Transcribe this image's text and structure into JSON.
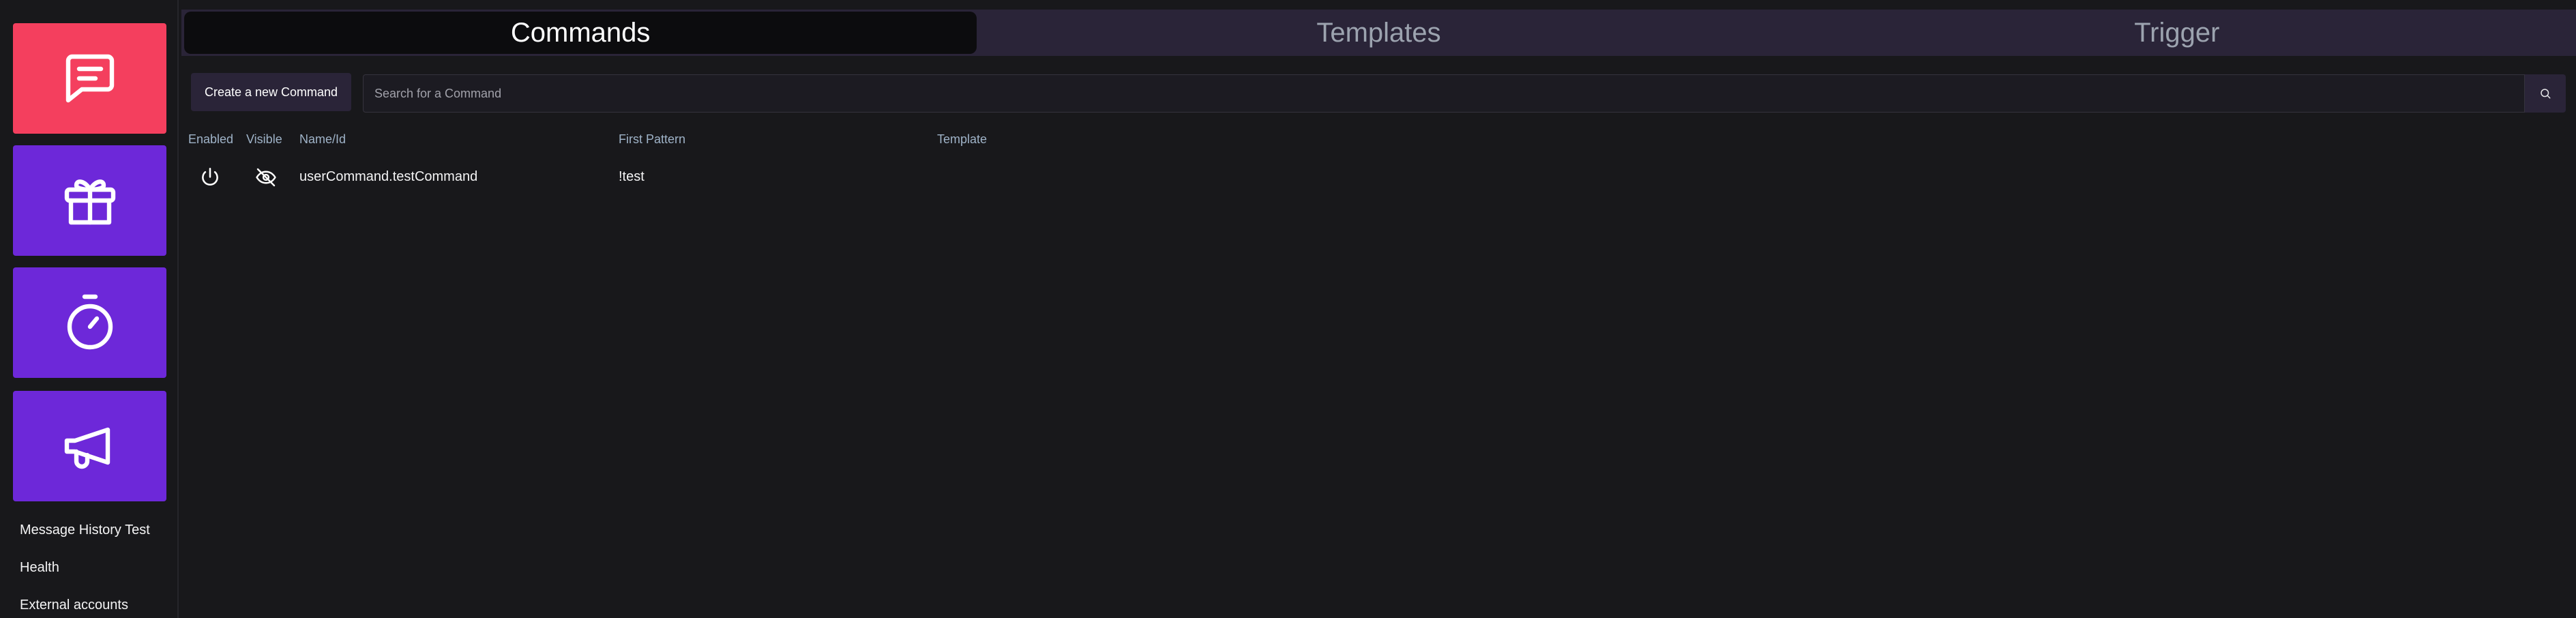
{
  "sidebar": {
    "tiles": [
      {
        "icon": "chat-icon",
        "color": "#f43f5e"
      },
      {
        "icon": "gift-icon",
        "color": "#6d28d9"
      },
      {
        "icon": "timer-icon",
        "color": "#6d28d9"
      },
      {
        "icon": "megaphone-icon",
        "color": "#6d28d9"
      }
    ],
    "links": [
      "Message History Test",
      "Health",
      "External accounts"
    ]
  },
  "tabs": [
    {
      "label": "Commands",
      "active": true
    },
    {
      "label": "Templates",
      "active": false
    },
    {
      "label": "Trigger",
      "active": false
    }
  ],
  "toolbar": {
    "create_label": "Create a new Command",
    "search_placeholder": "Search for a Command",
    "search_value": "",
    "search_icon": "search-icon"
  },
  "table": {
    "headers": [
      "Enabled",
      "Visible",
      "Name/Id",
      "First Pattern",
      "Template"
    ],
    "rows": [
      {
        "enabled_icon": "power-icon",
        "visible_icon": "eye-off-icon",
        "name": "userCommand.testCommand",
        "pattern": "!test",
        "template": ""
      }
    ]
  },
  "colors": {
    "background": "#18181b",
    "accent_pink": "#f43f5e",
    "accent_purple": "#6d28d9",
    "tabbar": "#2a2438"
  }
}
